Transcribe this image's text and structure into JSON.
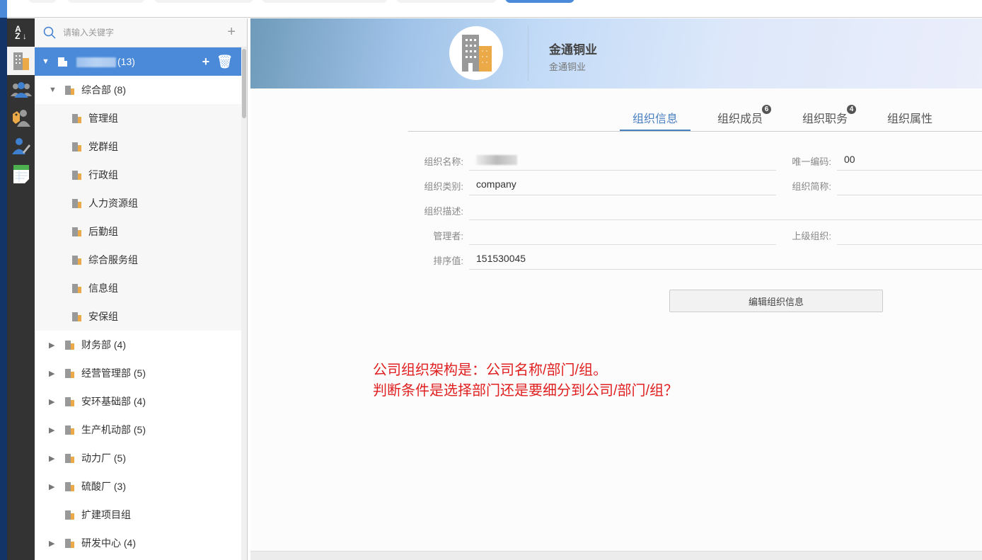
{
  "search": {
    "placeholder": "请输入关键字"
  },
  "tree": {
    "root": {
      "count": "(13)"
    },
    "items": [
      {
        "label": "综合部 (8)",
        "level": 1,
        "state": "expanded"
      },
      {
        "label": "管理组",
        "level": 2
      },
      {
        "label": "党群组",
        "level": 2
      },
      {
        "label": "行政组",
        "level": 2
      },
      {
        "label": "人力资源组",
        "level": 2
      },
      {
        "label": "后勤组",
        "level": 2
      },
      {
        "label": "综合服务组",
        "level": 2
      },
      {
        "label": "信息组",
        "level": 2
      },
      {
        "label": "安保组",
        "level": 2
      },
      {
        "label": "财务部 (4)",
        "level": 1,
        "state": "collapsed"
      },
      {
        "label": "经营管理部 (5)",
        "level": 1,
        "state": "collapsed"
      },
      {
        "label": "安环基础部 (4)",
        "level": 1,
        "state": "collapsed"
      },
      {
        "label": "生产机动部 (5)",
        "level": 1,
        "state": "collapsed"
      },
      {
        "label": "动力厂 (5)",
        "level": 1,
        "state": "collapsed"
      },
      {
        "label": "硫酸厂 (3)",
        "level": 1,
        "state": "collapsed"
      },
      {
        "label": "扩建项目组",
        "level": 1,
        "state": "leaf"
      },
      {
        "label": "研发中心 (4)",
        "level": 1,
        "state": "collapsed"
      }
    ]
  },
  "banner": {
    "title": "金通铜业",
    "subtitle": "金通铜业"
  },
  "tabs": [
    {
      "label": "组织信息",
      "active": true
    },
    {
      "label": "组织成员",
      "badge": "6"
    },
    {
      "label": "组织职务",
      "badge": "4"
    },
    {
      "label": "组织属性"
    }
  ],
  "form": {
    "name_label": "组织名称:",
    "name_value": "",
    "code_label": "唯一编码:",
    "code_value": "00",
    "type_label": "组织类别:",
    "type_value": "company",
    "short_label": "组织简称:",
    "short_value": "",
    "desc_label": "组织描述:",
    "desc_value": "",
    "manager_label": "管理者:",
    "manager_value": "",
    "parent_label": "上级组织:",
    "parent_value": "",
    "sort_label": "排序值:",
    "sort_value": "151530045"
  },
  "edit_button": "编辑组织信息",
  "annotation": {
    "line1": "公司组织架构是：公司名称/部门/组。",
    "line2": "判断条件是选择部门还是要细分到公司/部门/组？"
  },
  "colors": {
    "accent": "#4a8ad8",
    "annotation": "#e02020"
  }
}
